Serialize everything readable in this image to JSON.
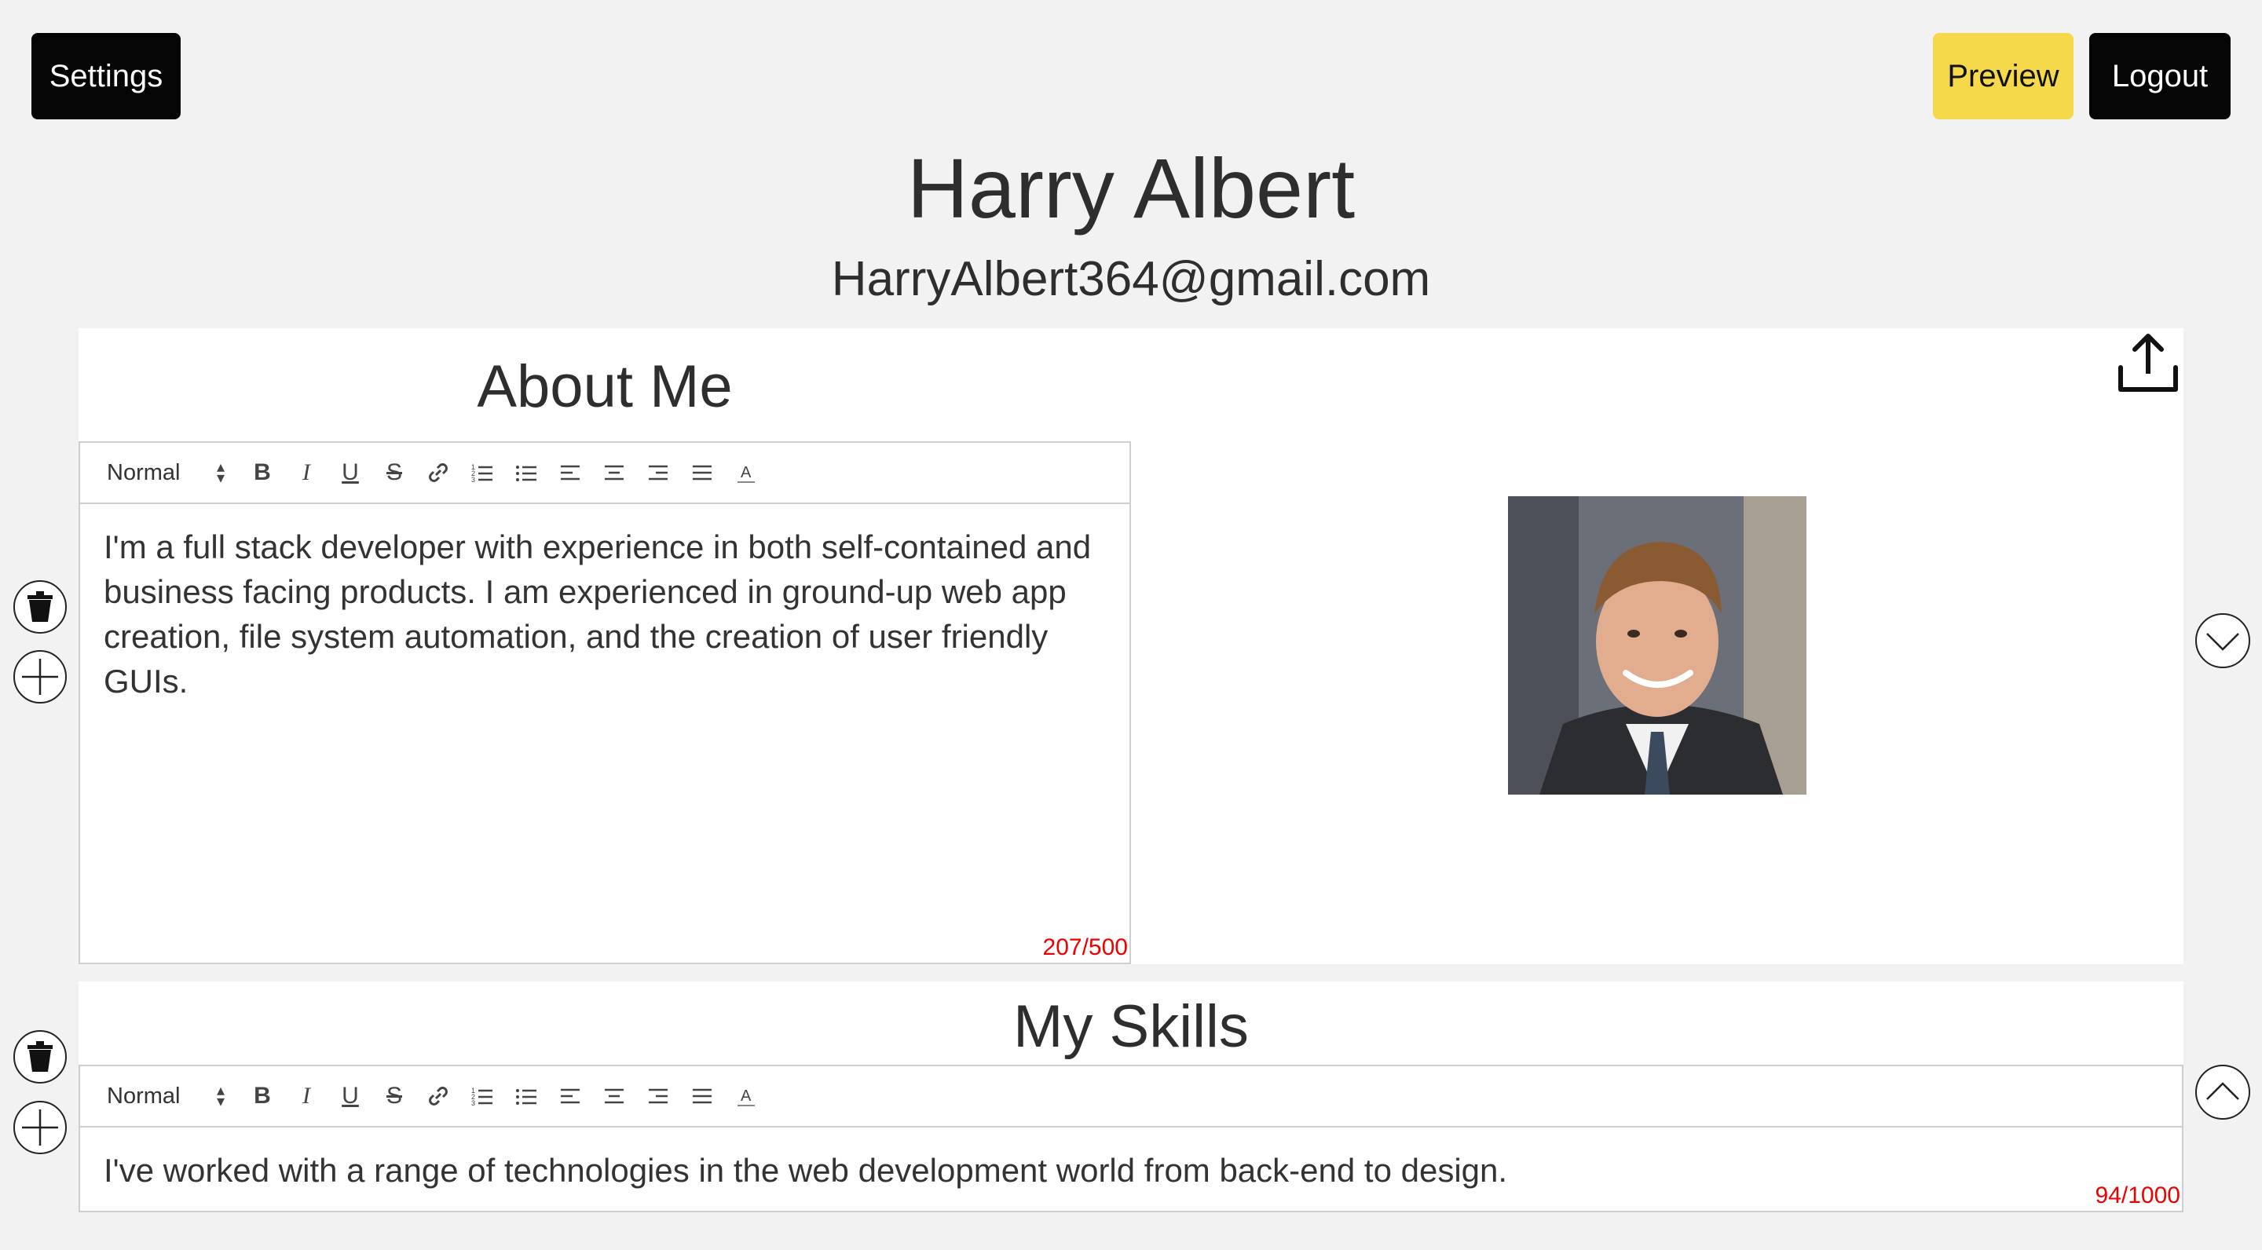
{
  "header": {
    "settings_label": "Settings",
    "preview_label": "Preview",
    "logout_label": "Logout"
  },
  "profile": {
    "name": "Harry Albert",
    "email": "HarryAlbert364@gmail.com"
  },
  "sections": {
    "about": {
      "title": "About Me",
      "format_select": "Normal",
      "body": "I'm a full stack developer with experience in both self-contained and business facing products. I am experienced in ground-up web app creation, file system automation, and the creation of user friendly GUIs.",
      "counter": "207/500"
    },
    "skills": {
      "title": "My Skills",
      "format_select": "Normal",
      "body": "I've worked with a range of technologies in the web development world from back-end to design.",
      "counter": "94/1000"
    }
  },
  "colors": {
    "background": "#f2f2f2",
    "dark_button": "#050505",
    "preview_button": "#f6d94a",
    "counter": "#ee0000"
  },
  "icons": [
    "trash-icon",
    "add-circle-icon",
    "upload-icon",
    "chevron-down-circle-icon",
    "chevron-up-circle-icon",
    "bold-icon",
    "italic-icon",
    "underline-icon",
    "strike-icon",
    "link-icon",
    "ordered-list-icon",
    "bullet-list-icon",
    "align-left-icon",
    "align-center-icon",
    "align-right-icon",
    "align-justify-icon",
    "text-color-icon"
  ]
}
